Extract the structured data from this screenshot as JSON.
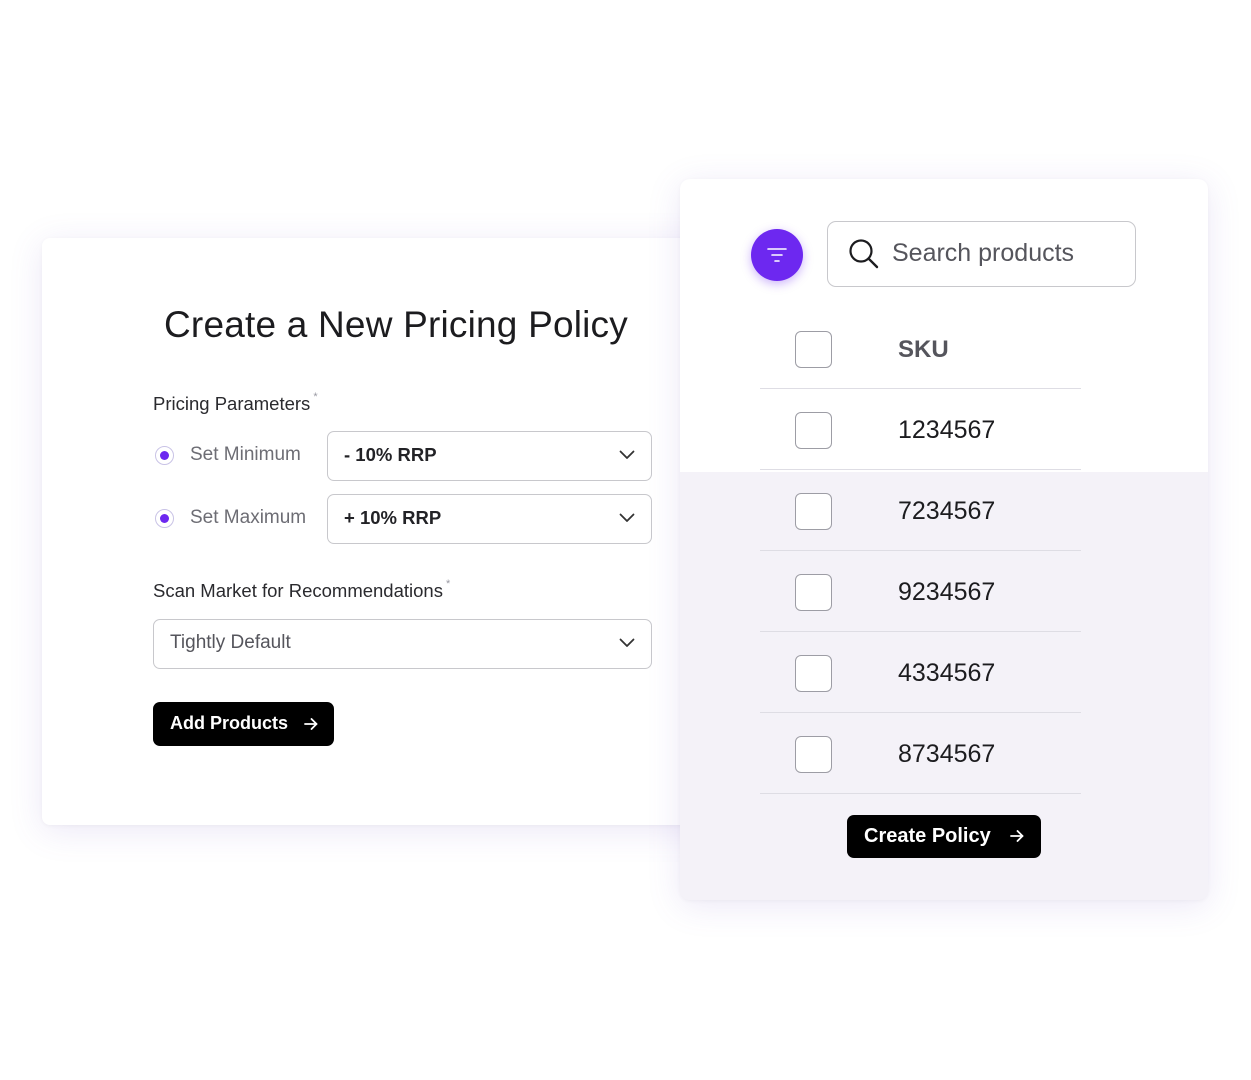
{
  "policy_form": {
    "title": "Create a New Pricing Policy",
    "pricing_parameters": {
      "label": "Pricing Parameters",
      "required_marker": "*",
      "minimum": {
        "label": "Set Minimum",
        "selected": true,
        "value": "- 10% RRP"
      },
      "maximum": {
        "label": "Set Maximum",
        "selected": true,
        "value": "+ 10% RRP"
      }
    },
    "scan_market": {
      "label": "Scan Market for Recommendations",
      "required_marker": "*",
      "value": "Tightly Default"
    },
    "add_button_label": "Add Products"
  },
  "product_list": {
    "filter_icon": "filter-icon",
    "search": {
      "placeholder": "Search products",
      "icon": "search-icon"
    },
    "column_header": "SKU",
    "rows": [
      {
        "sku": "1234567",
        "checked": false
      },
      {
        "sku": "7234567",
        "checked": false
      },
      {
        "sku": "9234567",
        "checked": false
      },
      {
        "sku": "4334567",
        "checked": false
      },
      {
        "sku": "8734567",
        "checked": false
      }
    ],
    "create_button_label": "Create Policy"
  },
  "colors": {
    "accent": "#6d28f0",
    "button_bg": "#000000",
    "list_bg": "#f4f2f8"
  }
}
